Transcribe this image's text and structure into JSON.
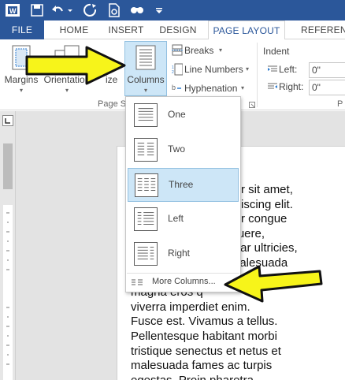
{
  "qat": {
    "icons": [
      "word-logo-icon",
      "save-icon",
      "undo-icon",
      "undo-dropdown-icon",
      "redo-icon",
      "print-preview-icon",
      "find-icon",
      "qat-dropdown-icon"
    ]
  },
  "tabs": {
    "file": "FILE",
    "home": "HOME",
    "insert": "INSERT",
    "design": "DESIGN",
    "page_layout": "PAGE LAYOUT",
    "references": "REFERENC"
  },
  "ribbon": {
    "margins": "Margins",
    "orientation": "Orientation",
    "size": "ize",
    "columns": "Columns",
    "breaks": "Breaks",
    "line_numbers": "Line Numbers",
    "hyphenation": "Hyphenation",
    "group_page_setup": "Page S",
    "group_paragraph": "P",
    "indent_title": "Indent",
    "left_label": "Left:",
    "left_value": "0\"",
    "right_label": "Right:",
    "right_value": "0\""
  },
  "columns_menu": {
    "items": [
      {
        "label": "One",
        "selected": false
      },
      {
        "label": "Two",
        "selected": false
      },
      {
        "label": "Three",
        "selected": true
      },
      {
        "label": "Left",
        "selected": false
      },
      {
        "label": "Right",
        "selected": false
      }
    ],
    "more": "More Columns..."
  },
  "document": {
    "lines": [
      "olor sit amet,",
      "dipiscing elit.",
      "titor congue",
      "osuere,",
      "vinar ultricies,",
      "nalesuada",
      "ommodo",
      "magna eros q",
      "viverra imperdiet enim.",
      "Fusce est. Vivamus a tellus.",
      "Pellentesque habitant morbi",
      "tristique senectus et netus et",
      "malesuada fames ac turpis",
      "egestas. Proin pharetra"
    ]
  },
  "colors": {
    "brand": "#2b579a",
    "arrow_yellow": "#f7f41a",
    "selected_bg": "#cde6f7"
  }
}
